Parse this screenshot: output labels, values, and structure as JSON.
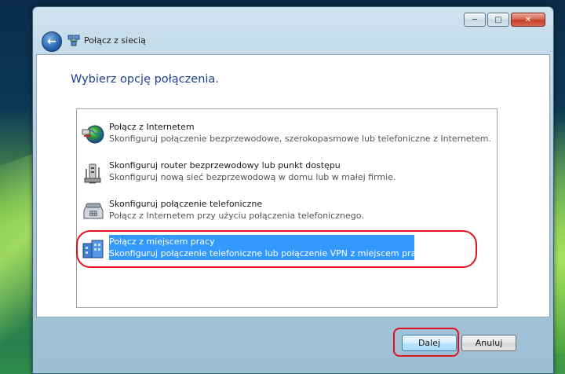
{
  "window": {
    "title": "Połącz z siecią",
    "controls": {
      "minimize": "─",
      "maximize": "□",
      "close": "✕"
    }
  },
  "main": {
    "heading": "Wybierz opcję połączenia.",
    "options": [
      {
        "title": "Połącz z Internetem",
        "desc": "Skonfiguruj połączenie bezprzewodowe, szerokopasmowe lub telefoniczne z Internetem.",
        "icon": "globe-network-icon"
      },
      {
        "title": "Skonfiguruj router bezprzewodowy lub punkt dostępu",
        "desc": "Skonfiguruj nową sieć bezprzewodową w domu lub w małej firmie.",
        "icon": "wireless-router-icon"
      },
      {
        "title": "Skonfiguruj połączenie telefoniczne",
        "desc": "Połącz z Internetem przy użyciu połączenia telefonicznego.",
        "icon": "telephone-modem-icon"
      },
      {
        "title": "Połącz z miejscem pracy",
        "desc": "Skonfiguruj połączenie telefoniczne lub połączenie VPN z miejscem pracy.",
        "icon": "workplace-vpn-icon",
        "selected": true
      }
    ]
  },
  "buttons": {
    "next": "Dalej",
    "cancel": "Anuluj"
  },
  "colors": {
    "selection": "#3399ff",
    "highlight_ring": "#e0141e",
    "heading": "#1e3e8a"
  }
}
